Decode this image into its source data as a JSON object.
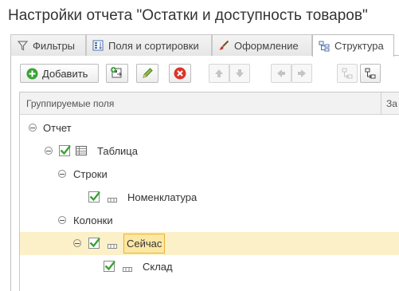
{
  "window": {
    "title": "Настройки отчета \"Остатки и доступность товаров\""
  },
  "tabs": [
    {
      "label": "Фильтры",
      "icon": "filter-icon"
    },
    {
      "label": "Поля и сортировки",
      "icon": "fields-icon"
    },
    {
      "label": "Оформление",
      "icon": "brush-icon"
    },
    {
      "label": "Структура",
      "icon": "structure-icon",
      "active": true
    }
  ],
  "toolbar": {
    "add_label": "Добавить",
    "buttons": [
      "add-button",
      "add-grouping-button",
      "edit-button",
      "delete-button",
      "move-up-button",
      "move-down-button",
      "move-left-button",
      "move-right-button",
      "group-in-button",
      "group-out-button"
    ]
  },
  "tree": {
    "header": {
      "col1": "Группируемые поля",
      "col2": "За"
    },
    "rows": [
      {
        "label": "Отчет",
        "level": 0,
        "checkbox": false,
        "icon": null
      },
      {
        "label": "Таблица",
        "level": 1,
        "checkbox": true,
        "checked": true,
        "icon": "table-icon"
      },
      {
        "label": "Строки",
        "level": 2,
        "checkbox": false,
        "icon": null
      },
      {
        "label": "Номенклатура",
        "level": 3,
        "checkbox": true,
        "checked": true,
        "icon": "field-icon"
      },
      {
        "label": "Колонки",
        "level": 2,
        "checkbox": false,
        "icon": null
      },
      {
        "label": "Сейчас",
        "level": 3,
        "checkbox": true,
        "checked": true,
        "icon": "field-icon",
        "selected": true
      },
      {
        "label": "Склад",
        "level": 4,
        "checkbox": true,
        "checked": true,
        "icon": "field-icon"
      }
    ]
  },
  "colors": {
    "selected_row": "#fbf0c8",
    "focus_border": "#e7b23a",
    "check_green": "#3aa236",
    "delete_red": "#d9352b"
  }
}
